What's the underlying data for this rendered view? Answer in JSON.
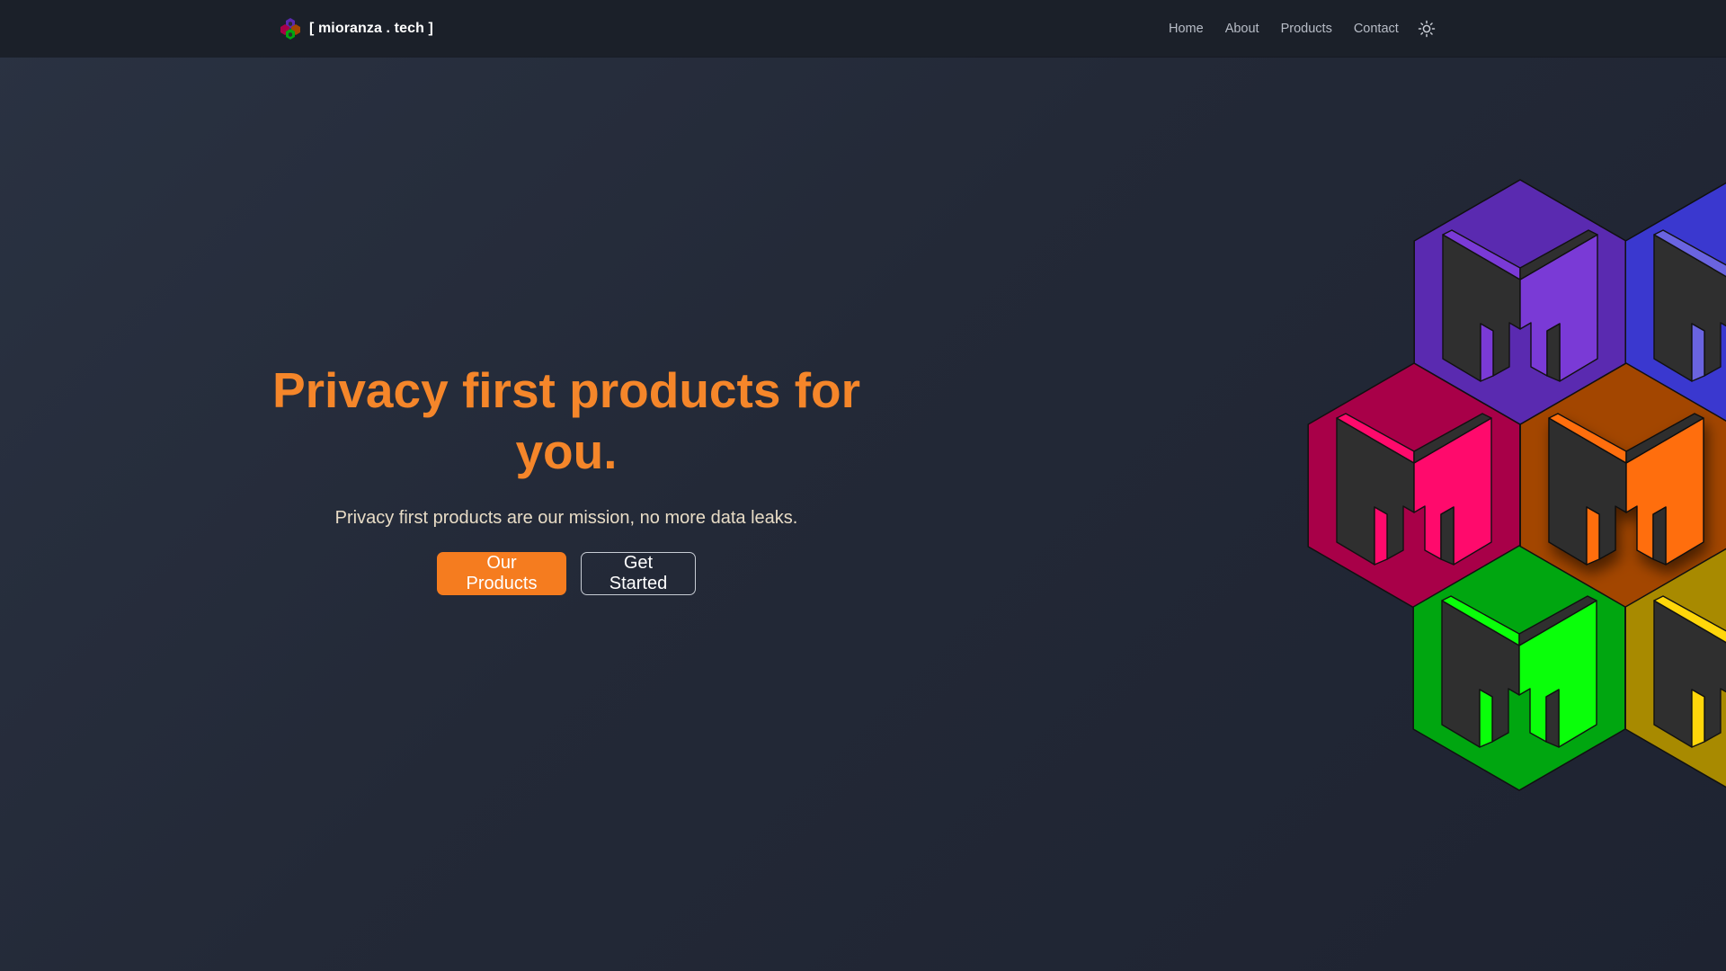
{
  "navbar": {
    "brand": "[ mioranza . tech ]",
    "links": [
      "Home",
      "About",
      "Products",
      "Contact"
    ],
    "theme_toggle_icon": "sun-icon"
  },
  "hero": {
    "title_line1": "Privacy first products for",
    "title_line2": "you.",
    "subtitle": "Privacy first products are our mission, no more data leaks.",
    "primary_button": "Our Products",
    "secondary_button": "Get Started"
  },
  "hero_art": {
    "icon": "hexagon-logo-grid",
    "tiles": [
      {
        "name": "purple",
        "hex": "#5a2ab0",
        "face": "#7a3ad6"
      },
      {
        "name": "blue",
        "hex": "#3a38cf",
        "face": "#6a64e0"
      },
      {
        "name": "pink",
        "hex": "#a80048",
        "face": "#ff0a6c"
      },
      {
        "name": "orange",
        "hex": "#a34600",
        "face": "#ff6e0a"
      },
      {
        "name": "green",
        "hex": "#00a610",
        "face": "#0aff0a"
      },
      {
        "name": "yellow",
        "hex": "#a88a00",
        "face": "#ffd60a"
      }
    ]
  },
  "colors": {
    "accent": "#f57c1f",
    "title": "#f5862a",
    "subtitle": "#e8dcc6",
    "navbar_bg": "#1b2029"
  }
}
